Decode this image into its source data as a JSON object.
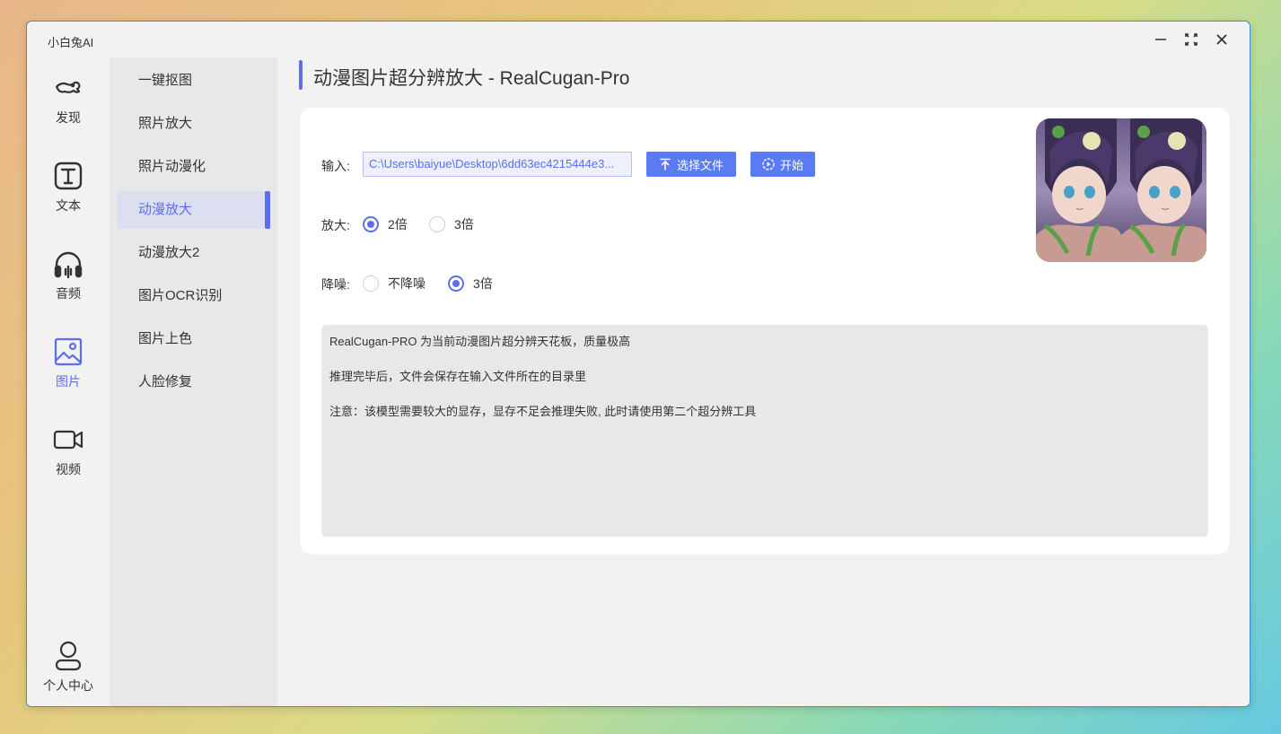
{
  "app": {
    "title": "小白兔AI"
  },
  "window_controls": {
    "minimize": "minimize-icon",
    "maximize": "maximize-icon",
    "close": "close-icon"
  },
  "nav": [
    {
      "label": "发现",
      "icon": "discover-icon"
    },
    {
      "label": "文本",
      "icon": "text-icon"
    },
    {
      "label": "音频",
      "icon": "headphones-icon"
    },
    {
      "label": "图片",
      "icon": "image-icon",
      "active": true
    },
    {
      "label": "视频",
      "icon": "video-icon"
    }
  ],
  "user_center": {
    "label": "个人中心",
    "icon": "user-icon"
  },
  "submenu": [
    {
      "label": "一键抠图"
    },
    {
      "label": "照片放大"
    },
    {
      "label": "照片动漫化"
    },
    {
      "label": "动漫放大",
      "active": true
    },
    {
      "label": "动漫放大2"
    },
    {
      "label": "图片OCR识别"
    },
    {
      "label": "图片上色"
    },
    {
      "label": "人脸修复"
    }
  ],
  "page": {
    "title": "动漫图片超分辨放大 - RealCugan-Pro"
  },
  "form": {
    "input_label": "输入:",
    "input_value": "C:\\Users\\baiyue\\Desktop\\6dd63ec4215444e3...",
    "choose_file": "选择文件",
    "start": "开始",
    "scale_label": "放大:",
    "scale_options": [
      "2倍",
      "3倍"
    ],
    "scale_selected": "2倍",
    "denoise_label": "降噪:",
    "denoise_options": [
      "不降噪",
      "3倍"
    ],
    "denoise_selected": "3倍"
  },
  "info": [
    "RealCugan-PRO 为当前动漫图片超分辨天花板，质量极高",
    "推理完毕后，文件会保存在输入文件所在的目录里",
    "注意：该模型需要较大的显存，显存不足会推理失败, 此时请使用第二个超分辨工具"
  ],
  "colors": {
    "accent": "#5b6ef0",
    "button": "#5b7bf5"
  }
}
